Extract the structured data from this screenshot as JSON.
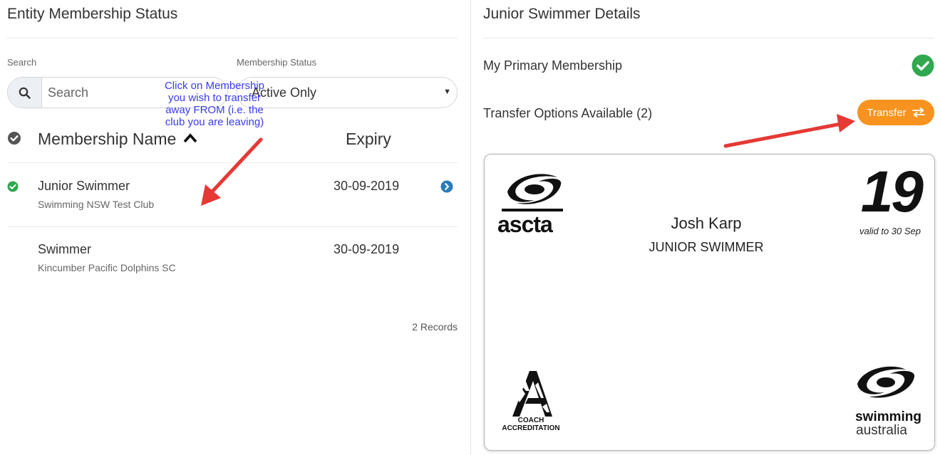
{
  "left_panel": {
    "title": "Entity Membership Status",
    "search_label": "Search",
    "search_placeholder": "Search",
    "status_label": "Membership Status",
    "status_value": "Active Only",
    "columns": {
      "name": "Membership Name",
      "expiry": "Expiry"
    },
    "rows": [
      {
        "name": "Junior Swimmer",
        "club": "Swimming NSW Test Club",
        "expiry": "30-09-2019",
        "active": true
      },
      {
        "name": "Swimmer",
        "club": "Kincumber Pacific Dolphins SC",
        "expiry": "30-09-2019",
        "active": false
      }
    ],
    "records": "2 Records"
  },
  "annotation": {
    "lines": [
      "Click on Membership",
      "you wish to transfer",
      "away FROM (i.e. the",
      "club you are leaving)"
    ],
    "color": "#3a3af0",
    "arrow_color": "#e53935"
  },
  "right_panel": {
    "title": "Junior Swimmer Details",
    "primary_label": "My Primary Membership",
    "transfer_label": "Transfer Options Available (2)",
    "transfer_button": "Transfer",
    "transfer_color": "#f7931e",
    "check_color": "#2fa84f"
  },
  "card": {
    "name": "Josh Karp",
    "role": "JUNIOR SWIMMER",
    "year": "19",
    "valid": "valid to 30 Sep",
    "logo_left_text": "ascta",
    "coach_line1": "COACH",
    "coach_line2": "ACCREDITATION",
    "sa_line1": "swimming",
    "sa_line2": "australia"
  },
  "icons": {
    "search": "search-icon",
    "check": "check-circle-icon",
    "sort": "chevron-up-icon",
    "row_open": "chevron-right-circle-icon",
    "transfer": "swap-arrows-icon"
  }
}
